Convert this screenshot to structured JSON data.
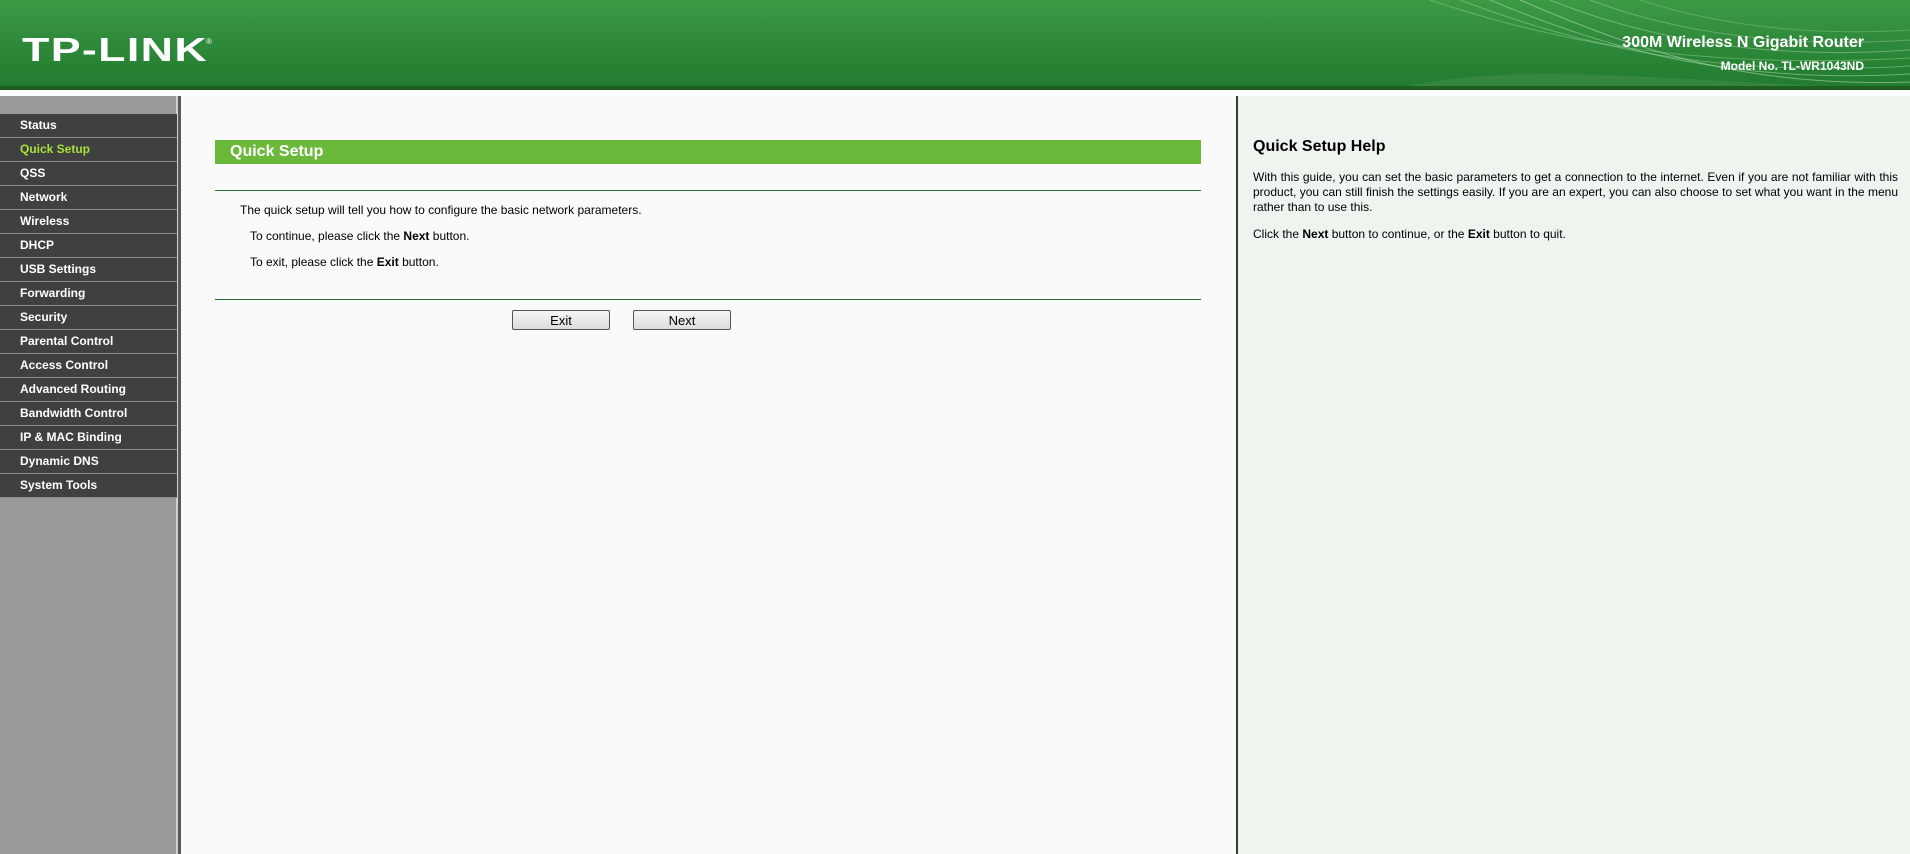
{
  "header": {
    "logo_text": "TP-LINK",
    "product_title": "300M Wireless N Gigabit Router",
    "model_no": "Model No. TL-WR1043ND"
  },
  "sidebar": {
    "items": [
      {
        "label": "Status",
        "active": false
      },
      {
        "label": "Quick Setup",
        "active": true
      },
      {
        "label": "QSS",
        "active": false
      },
      {
        "label": "Network",
        "active": false
      },
      {
        "label": "Wireless",
        "active": false
      },
      {
        "label": "DHCP",
        "active": false
      },
      {
        "label": "USB Settings",
        "active": false
      },
      {
        "label": "Forwarding",
        "active": false
      },
      {
        "label": "Security",
        "active": false
      },
      {
        "label": "Parental Control",
        "active": false
      },
      {
        "label": "Access Control",
        "active": false
      },
      {
        "label": "Advanced Routing",
        "active": false
      },
      {
        "label": "Bandwidth Control",
        "active": false
      },
      {
        "label": "IP & MAC Binding",
        "active": false
      },
      {
        "label": "Dynamic DNS",
        "active": false
      },
      {
        "label": "System Tools",
        "active": false
      }
    ]
  },
  "main": {
    "title": "Quick Setup",
    "intro": "The quick setup will tell you how to configure the basic network parameters.",
    "continue_prefix": "To continue, please click the ",
    "continue_bold": "Next",
    "continue_suffix": " button.",
    "exit_prefix": "To exit, please click the ",
    "exit_bold": "Exit",
    "exit_suffix": " button.",
    "exit_button": "Exit",
    "next_button": "Next"
  },
  "help": {
    "title": "Quick Setup Help",
    "paragraph": "With this guide, you can set the basic parameters to get a connection to the internet. Even if you are not familiar with this product, you can still finish the settings easily. If you are an expert, you can also choose to set what you want in the menu rather than to use this.",
    "p2_prefix": "Click the ",
    "p2_bold1": "Next",
    "p2_middle": " button to continue, or the ",
    "p2_bold2": "Exit",
    "p2_suffix": " button to quit."
  },
  "colors": {
    "header_green": "#2f8a3b",
    "title_bar_green": "#6ab93a",
    "nav_bg": "#404040",
    "nav_active_text": "#a6e23a",
    "sidebar_bg": "#999999",
    "help_bg": "#eef5ee"
  }
}
